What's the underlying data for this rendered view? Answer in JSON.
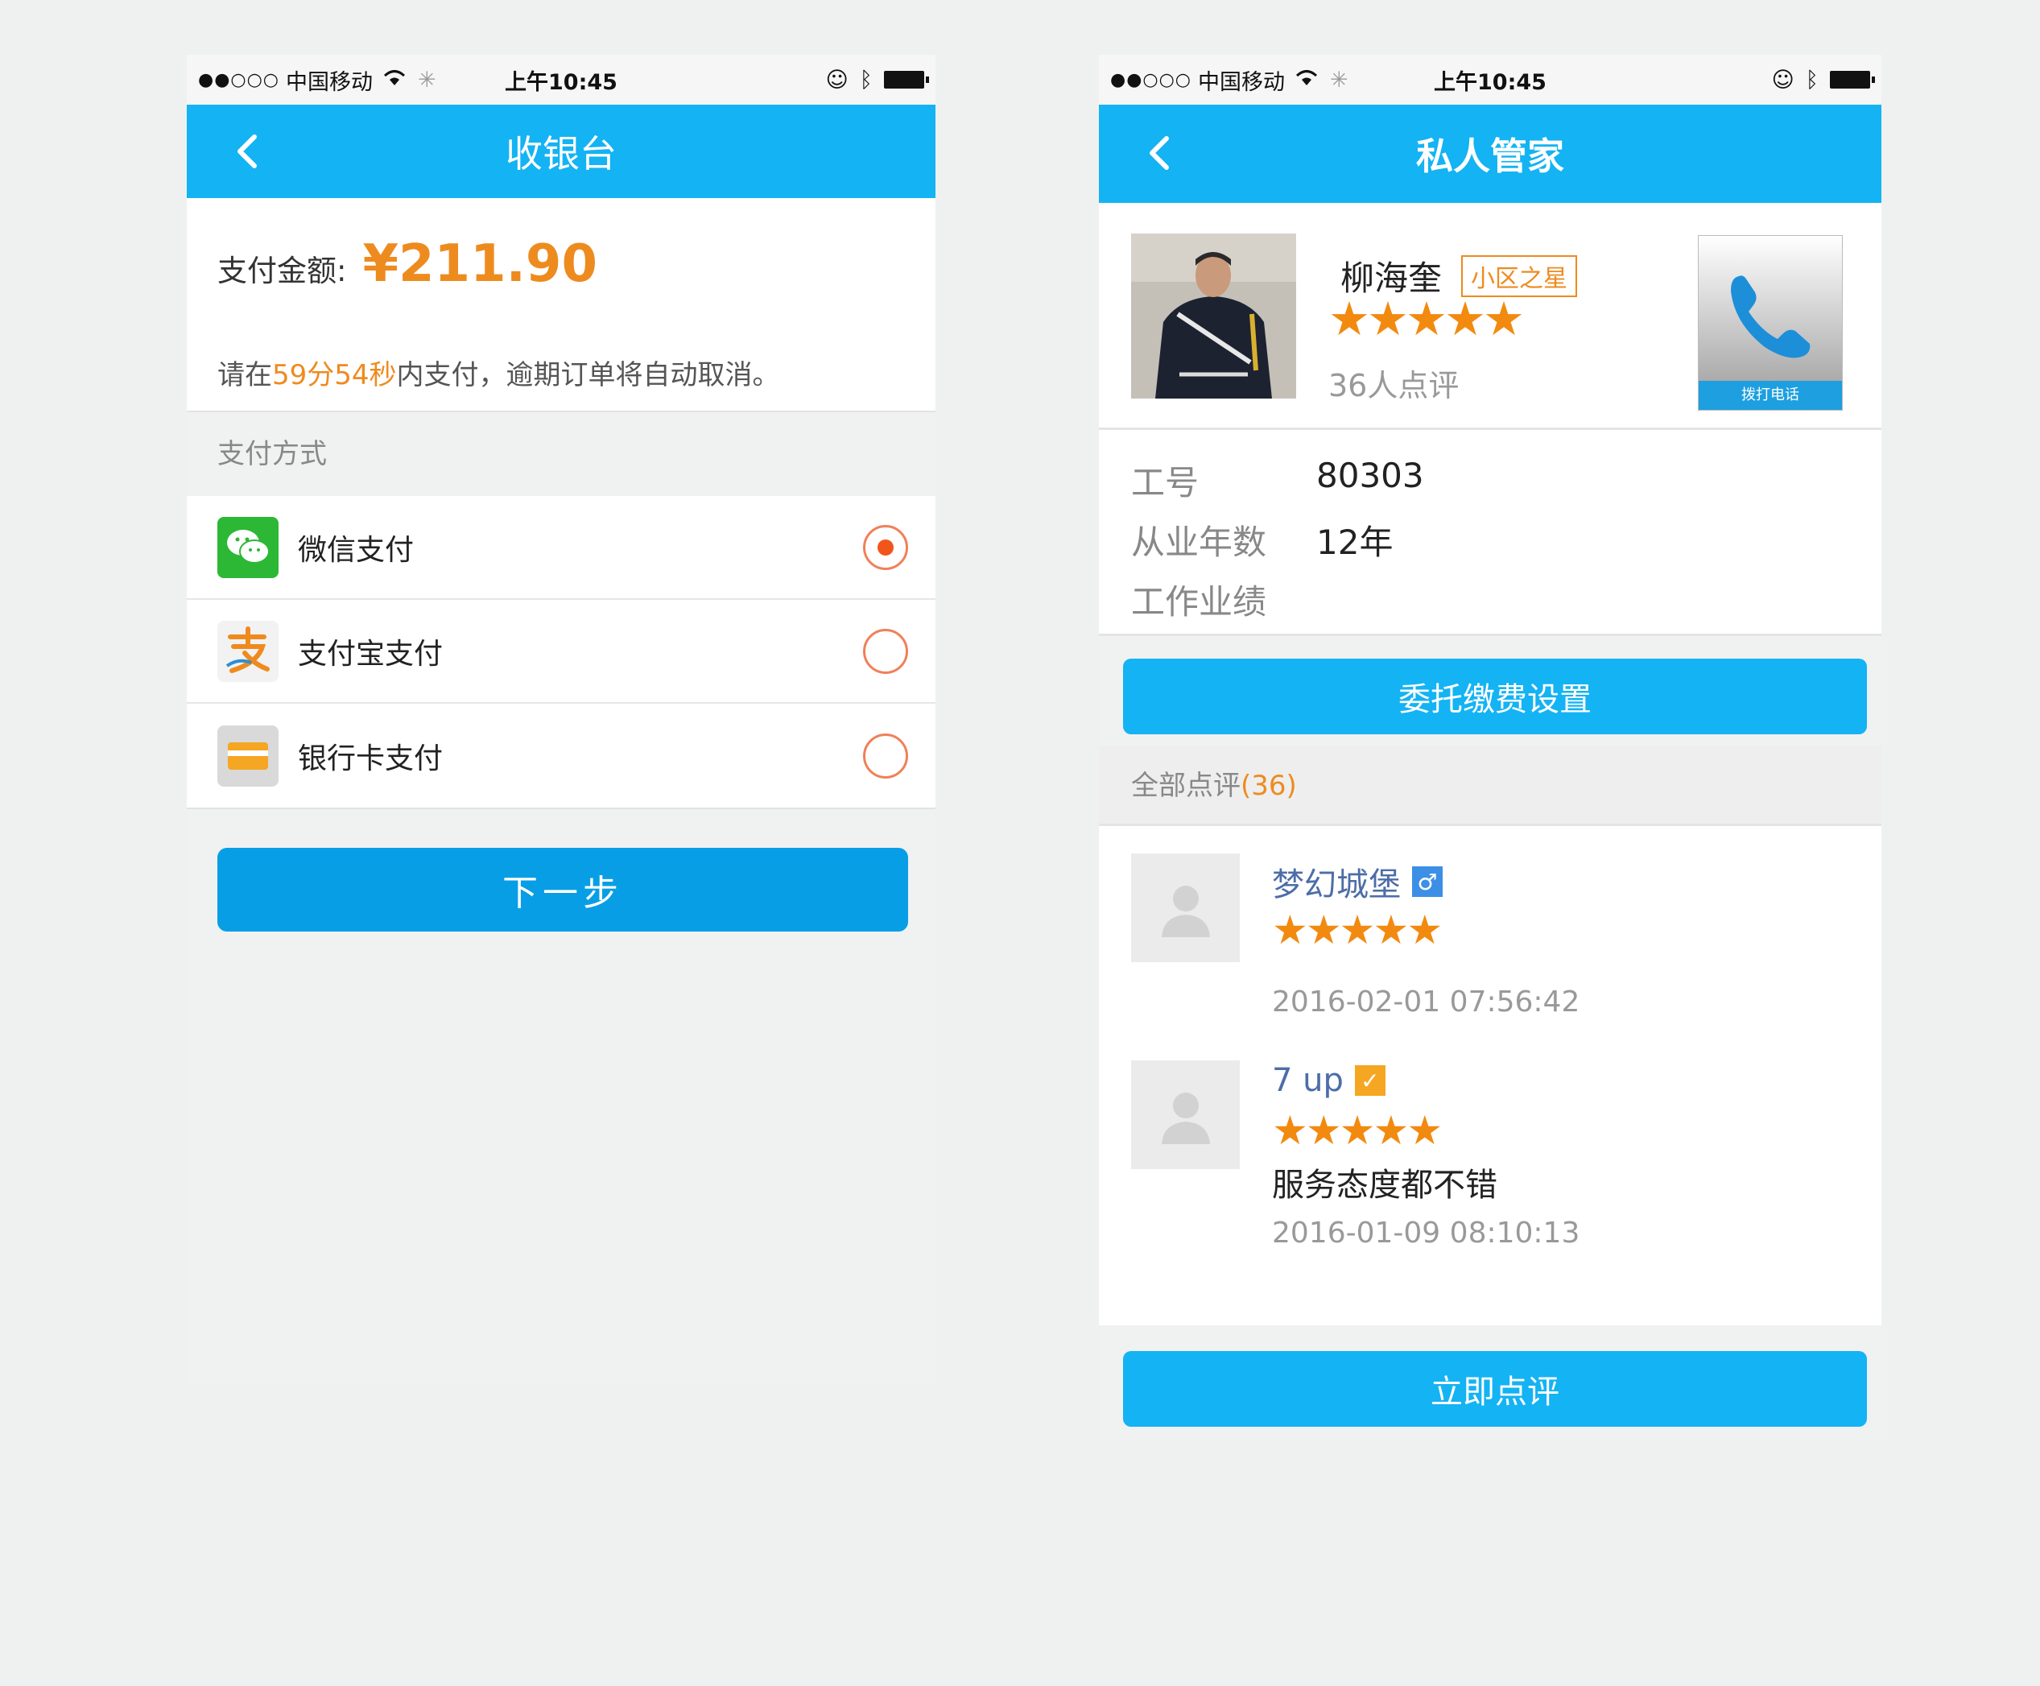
{
  "status_bar": {
    "signal": "●●○○○",
    "carrier": "中国移动",
    "time": "上午10:45"
  },
  "cashier": {
    "title": "收银台",
    "amount_label": "支付金额:",
    "amount_value": "¥211.90",
    "countdown_prefix": "请在",
    "countdown_highlight": "59分54秒",
    "countdown_suffix": "内支付，逾期订单将自动取消。",
    "section_label": "支付方式",
    "methods": [
      {
        "name": "微信支付",
        "icon": "wechat-icon",
        "selected": true
      },
      {
        "name": "支付宝支付",
        "icon": "alipay-icon",
        "selected": false
      },
      {
        "name": "银行卡支付",
        "icon": "bank-card-icon",
        "selected": false
      }
    ],
    "next_button": "下一步",
    "colors": {
      "nav": "#14b3f3",
      "button": "#089ee6",
      "accent": "#ee8b1f"
    }
  },
  "butler": {
    "title": "私人管家",
    "name": "柳海奎",
    "badge": "小区之星",
    "rating": 5,
    "review_count_text": "36人点评",
    "call_label": "拨打电话",
    "info": [
      {
        "key": "工号",
        "value": "80303"
      },
      {
        "key": "从业年数",
        "value": "12年"
      },
      {
        "key": "工作业绩",
        "value": ""
      }
    ],
    "entrust_button": "委托缴费设置",
    "reviews_label": "全部点评",
    "reviews_count": "(36)",
    "reviews": [
      {
        "user": "梦幻城堡",
        "badge": "♂",
        "badge_color": "#3d8fe6",
        "rating": 5,
        "text": "",
        "time": "2016-02-01 07:56:42"
      },
      {
        "user": "7 up",
        "badge": "✓",
        "badge_color": "#f5a623",
        "rating": 5,
        "text": "服务态度都不错",
        "time": "2016-01-09 08:10:13"
      }
    ],
    "review_button": "立即点评",
    "colors": {
      "nav": "#14b3f3",
      "star": "#f28a10"
    }
  }
}
